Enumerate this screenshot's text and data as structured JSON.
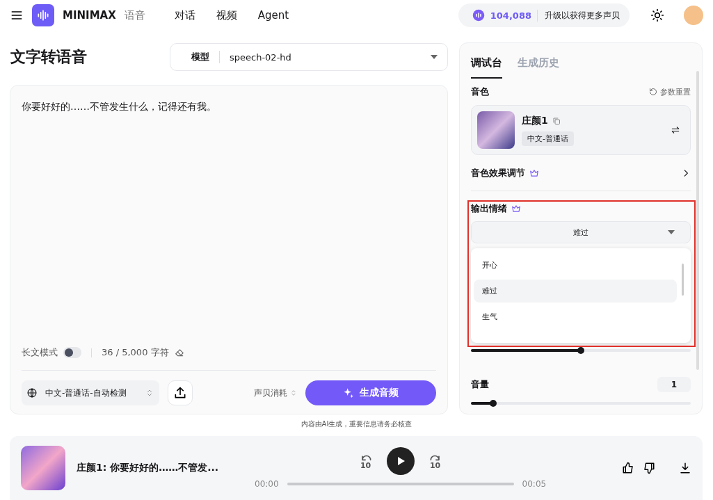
{
  "header": {
    "brand": "MINIMAX",
    "product": "语音",
    "nav": [
      {
        "label": "对话"
      },
      {
        "label": "视频"
      },
      {
        "label": "Agent"
      }
    ],
    "credits": "104,088",
    "upgrade": "升级以获得更多声贝"
  },
  "page_title": "文字转语音",
  "model": {
    "label": "模型",
    "value": "speech-02-hd"
  },
  "editor": {
    "text": "你要好好的……不管发生什么，记得还有我。",
    "long_mode_label": "长文模式",
    "long_mode_on": false,
    "count": "36 / 5,000 字符",
    "language": "中文-普通话-自动检测",
    "cost_label": "声贝消耗",
    "generate": "生成音频"
  },
  "disclaimer": "内容由AI生成，重要信息请务必核查",
  "panel": {
    "tabs": [
      {
        "label": "调试台",
        "selected": true
      },
      {
        "label": "生成历史",
        "selected": false
      }
    ],
    "voice_label": "音色",
    "reset": "参数重置",
    "voice": {
      "name": "庄颜1",
      "tag": "中文-普通话"
    },
    "effects": "音色效果调节",
    "emotion": {
      "label": "输出情绪",
      "value": "难过",
      "options": [
        {
          "label": "开心",
          "selected": false
        },
        {
          "label": "难过",
          "selected": true
        },
        {
          "label": "生气",
          "selected": false
        }
      ]
    },
    "hidden_slider": {
      "level": 0.5
    },
    "volume": {
      "label": "音量",
      "value": "1",
      "level": 0.1
    }
  },
  "player": {
    "title": "庄颜1: 你要好好的……不管发...",
    "skip_back": "10",
    "skip_forward": "10",
    "current": "00:00",
    "total": "00:05",
    "level": 0
  }
}
